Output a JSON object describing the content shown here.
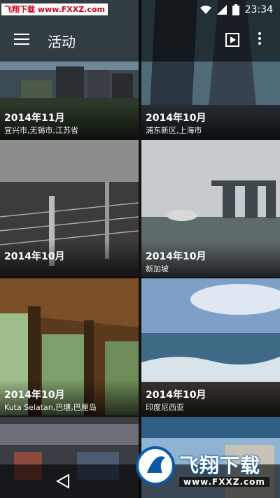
{
  "watermark": {
    "top_text": "飞翔下载 www.FXXZ.com",
    "bottom_text": "飞翔下载",
    "bottom_url": "www.FXXZ.com"
  },
  "status": {
    "time": "23:34"
  },
  "appbar": {
    "title": "活动",
    "menu_icon": "hamburger-menu-icon",
    "play_icon": "slideshow-play-icon",
    "more_icon": "more-vert-icon"
  },
  "tiles": [
    {
      "date": "2014年11月",
      "place": "宜兴市,无锡市,江苏省"
    },
    {
      "date": "2014年10月",
      "place": "浦东新区,上海市"
    },
    {
      "date": "2014年10月",
      "place": ""
    },
    {
      "date": "2014年10月",
      "place": "新加坡"
    },
    {
      "date": "2014年10月",
      "place": "Kuta Selatan,巴塘,巴厘岛"
    },
    {
      "date": "2014年10月",
      "place": "印度尼西亚"
    }
  ],
  "colors": {
    "accent": "#d0021b",
    "watermark_blue": "#0a5aa8"
  }
}
